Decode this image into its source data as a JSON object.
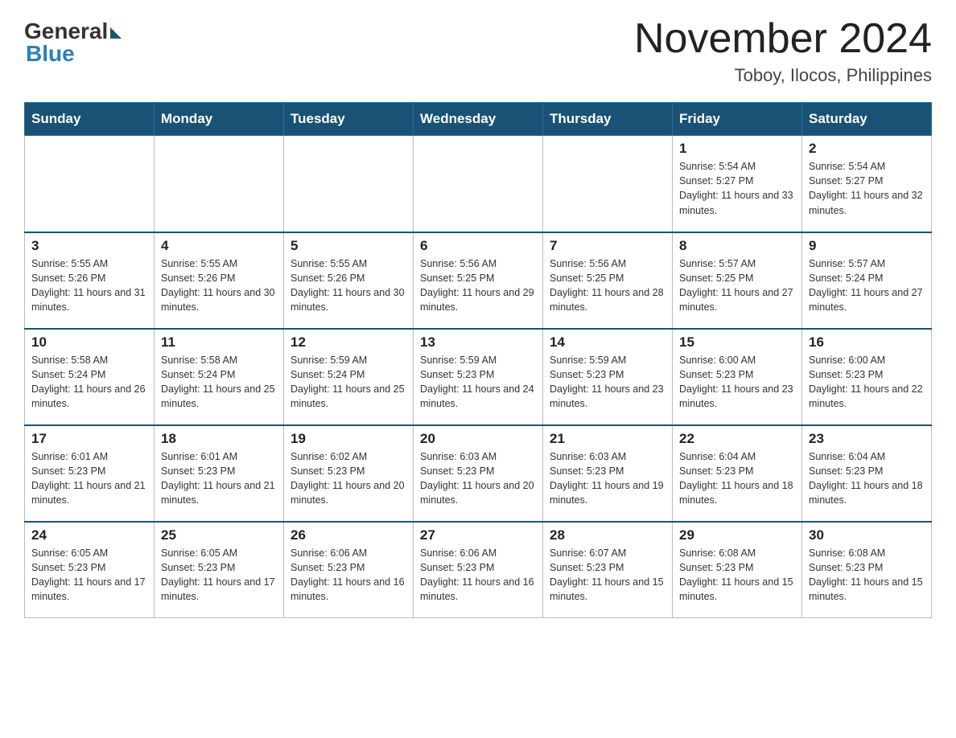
{
  "header": {
    "logo_general": "General",
    "logo_blue": "Blue",
    "month_title": "November 2024",
    "location": "Toboy, Ilocos, Philippines"
  },
  "days_of_week": [
    "Sunday",
    "Monday",
    "Tuesday",
    "Wednesday",
    "Thursday",
    "Friday",
    "Saturday"
  ],
  "weeks": [
    [
      {
        "day": "",
        "info": ""
      },
      {
        "day": "",
        "info": ""
      },
      {
        "day": "",
        "info": ""
      },
      {
        "day": "",
        "info": ""
      },
      {
        "day": "",
        "info": ""
      },
      {
        "day": "1",
        "info": "Sunrise: 5:54 AM\nSunset: 5:27 PM\nDaylight: 11 hours and 33 minutes."
      },
      {
        "day": "2",
        "info": "Sunrise: 5:54 AM\nSunset: 5:27 PM\nDaylight: 11 hours and 32 minutes."
      }
    ],
    [
      {
        "day": "3",
        "info": "Sunrise: 5:55 AM\nSunset: 5:26 PM\nDaylight: 11 hours and 31 minutes."
      },
      {
        "day": "4",
        "info": "Sunrise: 5:55 AM\nSunset: 5:26 PM\nDaylight: 11 hours and 30 minutes."
      },
      {
        "day": "5",
        "info": "Sunrise: 5:55 AM\nSunset: 5:26 PM\nDaylight: 11 hours and 30 minutes."
      },
      {
        "day": "6",
        "info": "Sunrise: 5:56 AM\nSunset: 5:25 PM\nDaylight: 11 hours and 29 minutes."
      },
      {
        "day": "7",
        "info": "Sunrise: 5:56 AM\nSunset: 5:25 PM\nDaylight: 11 hours and 28 minutes."
      },
      {
        "day": "8",
        "info": "Sunrise: 5:57 AM\nSunset: 5:25 PM\nDaylight: 11 hours and 27 minutes."
      },
      {
        "day": "9",
        "info": "Sunrise: 5:57 AM\nSunset: 5:24 PM\nDaylight: 11 hours and 27 minutes."
      }
    ],
    [
      {
        "day": "10",
        "info": "Sunrise: 5:58 AM\nSunset: 5:24 PM\nDaylight: 11 hours and 26 minutes."
      },
      {
        "day": "11",
        "info": "Sunrise: 5:58 AM\nSunset: 5:24 PM\nDaylight: 11 hours and 25 minutes."
      },
      {
        "day": "12",
        "info": "Sunrise: 5:59 AM\nSunset: 5:24 PM\nDaylight: 11 hours and 25 minutes."
      },
      {
        "day": "13",
        "info": "Sunrise: 5:59 AM\nSunset: 5:23 PM\nDaylight: 11 hours and 24 minutes."
      },
      {
        "day": "14",
        "info": "Sunrise: 5:59 AM\nSunset: 5:23 PM\nDaylight: 11 hours and 23 minutes."
      },
      {
        "day": "15",
        "info": "Sunrise: 6:00 AM\nSunset: 5:23 PM\nDaylight: 11 hours and 23 minutes."
      },
      {
        "day": "16",
        "info": "Sunrise: 6:00 AM\nSunset: 5:23 PM\nDaylight: 11 hours and 22 minutes."
      }
    ],
    [
      {
        "day": "17",
        "info": "Sunrise: 6:01 AM\nSunset: 5:23 PM\nDaylight: 11 hours and 21 minutes."
      },
      {
        "day": "18",
        "info": "Sunrise: 6:01 AM\nSunset: 5:23 PM\nDaylight: 11 hours and 21 minutes."
      },
      {
        "day": "19",
        "info": "Sunrise: 6:02 AM\nSunset: 5:23 PM\nDaylight: 11 hours and 20 minutes."
      },
      {
        "day": "20",
        "info": "Sunrise: 6:03 AM\nSunset: 5:23 PM\nDaylight: 11 hours and 20 minutes."
      },
      {
        "day": "21",
        "info": "Sunrise: 6:03 AM\nSunset: 5:23 PM\nDaylight: 11 hours and 19 minutes."
      },
      {
        "day": "22",
        "info": "Sunrise: 6:04 AM\nSunset: 5:23 PM\nDaylight: 11 hours and 18 minutes."
      },
      {
        "day": "23",
        "info": "Sunrise: 6:04 AM\nSunset: 5:23 PM\nDaylight: 11 hours and 18 minutes."
      }
    ],
    [
      {
        "day": "24",
        "info": "Sunrise: 6:05 AM\nSunset: 5:23 PM\nDaylight: 11 hours and 17 minutes."
      },
      {
        "day": "25",
        "info": "Sunrise: 6:05 AM\nSunset: 5:23 PM\nDaylight: 11 hours and 17 minutes."
      },
      {
        "day": "26",
        "info": "Sunrise: 6:06 AM\nSunset: 5:23 PM\nDaylight: 11 hours and 16 minutes."
      },
      {
        "day": "27",
        "info": "Sunrise: 6:06 AM\nSunset: 5:23 PM\nDaylight: 11 hours and 16 minutes."
      },
      {
        "day": "28",
        "info": "Sunrise: 6:07 AM\nSunset: 5:23 PM\nDaylight: 11 hours and 15 minutes."
      },
      {
        "day": "29",
        "info": "Sunrise: 6:08 AM\nSunset: 5:23 PM\nDaylight: 11 hours and 15 minutes."
      },
      {
        "day": "30",
        "info": "Sunrise: 6:08 AM\nSunset: 5:23 PM\nDaylight: 11 hours and 15 minutes."
      }
    ]
  ]
}
